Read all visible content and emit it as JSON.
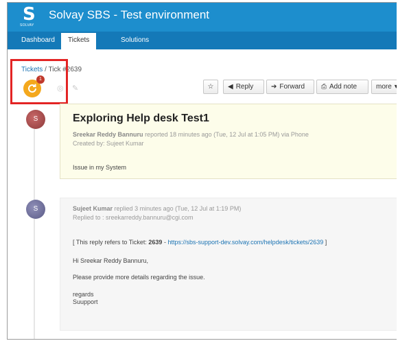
{
  "app": {
    "logo_letter": "S",
    "logo_word": "SOLVAY",
    "title": "Solvay SBS - Test environment"
  },
  "nav": {
    "tabs": [
      "Dashboard",
      "Tickets",
      "Solutions"
    ]
  },
  "breadcrumb": {
    "parent": "Tickets",
    "separator": "/",
    "current": "Tick",
    "ticket_id": "#2639"
  },
  "status": {
    "badge_count": "1"
  },
  "toolbar": {
    "reply": "Reply",
    "forward": "Forward",
    "add_note": "Add note",
    "more": "more"
  },
  "ticket": {
    "subject": "Exploring Help desk Test1",
    "requester": "Sreekar Reddy Bannuru",
    "reported_meta": "reported 18 minutes ago (Tue, 12 Jul at 1:05 PM) via Phone",
    "created_by": "Created by: Sujeet Kumar",
    "description": "Issue in my System",
    "avatar_initial": "S"
  },
  "reply": {
    "author": "Sujeet Kumar",
    "replied_meta": "replied 3 minutes ago (Tue, 12 Jul at 1:19 PM)",
    "replied_to": "Replied to : sreekarreddy.bannuru@cgi.com",
    "refers_prefix": "[ This reply refers to Ticket:",
    "refers_ticket": "2639",
    "refers_dash": "-",
    "refers_url": "https://sbs-support-dev.solvay.com/helpdesk/tickets/2639",
    "refers_suffix": "]",
    "greeting": "Hi Sreekar Reddy Bannuru,",
    "message": "Please provide more details regarding the issue.",
    "signoff": "regards",
    "signature": "Suupport",
    "avatar_initial": "S"
  },
  "colors": {
    "header": "#1d8ecd",
    "nav": "#1479b8",
    "status": "#f4a81d",
    "highlight": "#e32424",
    "link": "#1b73b3"
  }
}
